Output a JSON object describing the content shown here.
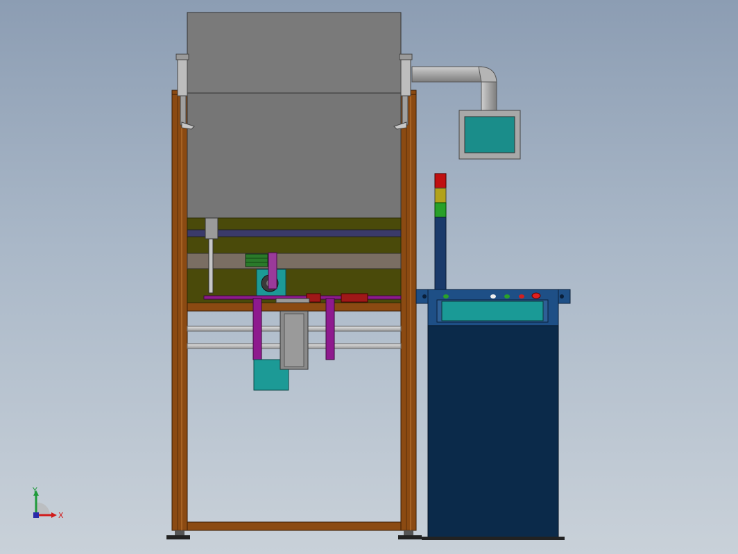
{
  "view": {
    "background_top": "#8c9db3",
    "background_bottom": "#c9d1d9"
  },
  "colors": {
    "frame_wood": "#8b4a12",
    "frame_dark": "#5a2e08",
    "hopper_gray": "#7a7a7a",
    "panel_olive": "#4a4a0a",
    "purple_part": "#8e1a8e",
    "teal_motor": "#1c9a96",
    "cabinet_navy": "#0b2a4a",
    "cabinet_blue": "#1e4f86",
    "screen_teal": "#1a8d8a",
    "duct_gray": "#a9a9a9",
    "tower_red": "#c01010",
    "tower_yellow": "#b2a21a",
    "tower_green": "#28a028",
    "tower_blue": "#1a3a6a"
  },
  "triad": {
    "x_label": "X",
    "y_label": "Y",
    "x_color": "#d11b1b",
    "y_color": "#1e9a3a",
    "z_color": "#2a2aa8"
  }
}
